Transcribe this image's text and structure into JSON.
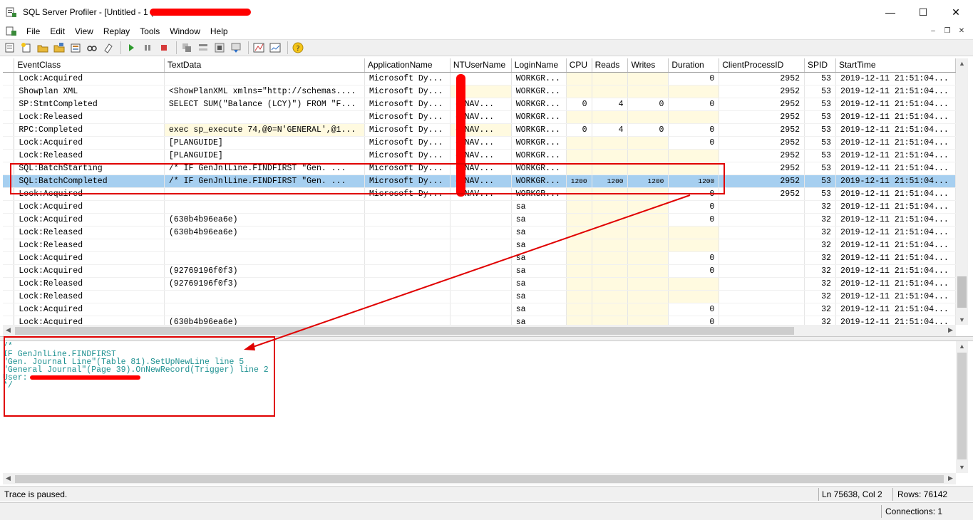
{
  "window": {
    "title": "SQL Server Profiler - [Untitled - 1 (",
    "minimize": "—",
    "maximize": "☐",
    "close": "✕"
  },
  "menu": {
    "items": [
      "File",
      "Edit",
      "View",
      "Replay",
      "Tools",
      "Window",
      "Help"
    ],
    "mdi": [
      "–",
      "❐",
      "✕"
    ]
  },
  "toolbar": {
    "icons": [
      "new-trace-icon",
      "new-template-icon",
      "open-icon",
      "save-icon",
      "properties-icon",
      "find-icon",
      "clear-trace-icon",
      "run-icon",
      "pause-icon",
      "stop-icon",
      "step-icon",
      "step-icon",
      "go-to-line-icon",
      "auto-scroll-icon",
      "performance-monitor-icon",
      "chart-icon",
      "help-icon"
    ]
  },
  "grid": {
    "columns": [
      "",
      "EventClass",
      "TextData",
      "ApplicationName",
      "NTUserName",
      "LoginName",
      "CPU",
      "Reads",
      "Writes",
      "Duration",
      "ClientProcessID",
      "SPID",
      "StartTime"
    ],
    "rows": [
      {
        "sel": false,
        "cells": [
          "",
          "Lock:Acquired",
          "",
          "Microsoft Dy...",
          "",
          "WORKGR...",
          "",
          "",
          "",
          "0",
          "2952",
          "53",
          "2019-12-11 21:51:04..."
        ],
        "yellow": [
          6,
          7,
          8
        ]
      },
      {
        "sel": false,
        "cells": [
          "",
          "Showplan XML",
          "<ShowPlanXML xmlns=\"http://schemas....",
          "Microsoft Dy...",
          "",
          "WORKGR...",
          "",
          "",
          "",
          "",
          "2952",
          "53",
          "2019-12-11 21:51:04..."
        ],
        "yellow": [
          4,
          6,
          7,
          8,
          9
        ]
      },
      {
        "sel": false,
        "cells": [
          "",
          "SP:StmtCompleted",
          "SELECT SUM(\"Balance (LCY)\") FROM \"F...",
          "Microsoft Dy...",
          "--NAV...",
          "WORKGR...",
          "0",
          "4",
          "0",
          "0",
          "2952",
          "53",
          "2019-12-11 21:51:04..."
        ],
        "yellow": []
      },
      {
        "sel": false,
        "cells": [
          "",
          "Lock:Released",
          "",
          "Microsoft Dy...",
          "--NAV...",
          "WORKGR...",
          "",
          "",
          "",
          "",
          "2952",
          "53",
          "2019-12-11 21:51:04..."
        ],
        "yellow": [
          6,
          7,
          8,
          9
        ]
      },
      {
        "sel": false,
        "cells": [
          "",
          "RPC:Completed",
          "exec sp_execute 74,@0=N'GENERAL',@1...",
          "Microsoft Dy...",
          "--NAV...",
          "WORKGR...",
          "0",
          "4",
          "0",
          "0",
          "2952",
          "53",
          "2019-12-11 21:51:04..."
        ],
        "yellow": [
          2,
          4
        ]
      },
      {
        "sel": false,
        "cells": [
          "",
          "Lock:Acquired",
          "[PLANGUIDE]",
          "Microsoft Dy...",
          "--NAV...",
          "WORKGR...",
          "",
          "",
          "",
          "0",
          "2952",
          "53",
          "2019-12-11 21:51:04..."
        ],
        "yellow": [
          6,
          7,
          8
        ]
      },
      {
        "sel": false,
        "cells": [
          "",
          "Lock:Released",
          "[PLANGUIDE]",
          "Microsoft Dy...",
          "--NAV...",
          "WORKGR...",
          "",
          "",
          "",
          "",
          "2952",
          "53",
          "2019-12-11 21:51:04..."
        ],
        "yellow": [
          6,
          7,
          8,
          9
        ]
      },
      {
        "sel": false,
        "cells": [
          "",
          "SQL:BatchStarting",
          "/*  IF GenJnlLine.FINDFIRST  \"Gen. ...",
          "Microsoft Dy...",
          "--NAV...",
          "WORKGR...",
          "",
          "",
          "",
          "",
          "2952",
          "53",
          "2019-12-11 21:51:04..."
        ],
        "yellow": [
          6,
          7,
          8,
          9
        ]
      },
      {
        "sel": true,
        "cells": [
          "",
          "SQL:BatchCompleted",
          "/*  IF GenJnlLine.FINDFIRST  \"Gen. ...",
          "Microsoft Dy...",
          "--NAV...",
          "WORKGR...",
          "1200",
          "1200",
          "1200",
          "1200",
          "2952",
          "53",
          "2019-12-11 21:51:04..."
        ],
        "yellow": []
      },
      {
        "sel": false,
        "cells": [
          "",
          "Lock:Acquired",
          "",
          "Microsoft Dy...",
          "--NAV...",
          "WORKGR...",
          "",
          "",
          "",
          "0",
          "2952",
          "53",
          "2019-12-11 21:51:04..."
        ],
        "yellow": [
          6,
          7,
          8
        ]
      },
      {
        "sel": false,
        "cells": [
          "",
          "Lock:Acquired",
          "",
          "",
          "",
          "sa",
          "",
          "",
          "",
          "0",
          "",
          "32",
          "2019-12-11 21:51:04..."
        ],
        "yellow": [
          6,
          7,
          8
        ]
      },
      {
        "sel": false,
        "cells": [
          "",
          "Lock:Acquired",
          "(630b4b96ea6e)",
          "",
          "",
          "sa",
          "",
          "",
          "",
          "0",
          "",
          "32",
          "2019-12-11 21:51:04..."
        ],
        "yellow": [
          6,
          7,
          8
        ]
      },
      {
        "sel": false,
        "cells": [
          "",
          "Lock:Released",
          "(630b4b96ea6e)",
          "",
          "",
          "sa",
          "",
          "",
          "",
          "",
          "",
          "32",
          "2019-12-11 21:51:04..."
        ],
        "yellow": [
          6,
          7,
          8,
          9
        ]
      },
      {
        "sel": false,
        "cells": [
          "",
          "Lock:Released",
          "",
          "",
          "",
          "sa",
          "",
          "",
          "",
          "",
          "",
          "32",
          "2019-12-11 21:51:04..."
        ],
        "yellow": [
          6,
          7,
          8,
          9
        ]
      },
      {
        "sel": false,
        "cells": [
          "",
          "Lock:Acquired",
          "",
          "",
          "",
          "sa",
          "",
          "",
          "",
          "0",
          "",
          "32",
          "2019-12-11 21:51:04..."
        ],
        "yellow": [
          6,
          7,
          8
        ]
      },
      {
        "sel": false,
        "cells": [
          "",
          "Lock:Acquired",
          "(92769196f0f3)",
          "",
          "",
          "sa",
          "",
          "",
          "",
          "0",
          "",
          "32",
          "2019-12-11 21:51:04..."
        ],
        "yellow": [
          6,
          7,
          8
        ]
      },
      {
        "sel": false,
        "cells": [
          "",
          "Lock:Released",
          "(92769196f0f3)",
          "",
          "",
          "sa",
          "",
          "",
          "",
          "",
          "",
          "32",
          "2019-12-11 21:51:04..."
        ],
        "yellow": [
          6,
          7,
          8,
          9
        ]
      },
      {
        "sel": false,
        "cells": [
          "",
          "Lock:Released",
          "",
          "",
          "",
          "sa",
          "",
          "",
          "",
          "",
          "",
          "32",
          "2019-12-11 21:51:04..."
        ],
        "yellow": [
          6,
          7,
          8,
          9
        ]
      },
      {
        "sel": false,
        "cells": [
          "",
          "Lock:Acquired",
          "",
          "",
          "",
          "sa",
          "",
          "",
          "",
          "0",
          "",
          "32",
          "2019-12-11 21:51:04..."
        ],
        "yellow": [
          6,
          7,
          8
        ]
      },
      {
        "sel": false,
        "cells": [
          "",
          "Lock:Acquired",
          "(630b4b96ea6e)",
          "",
          "",
          "sa",
          "",
          "",
          "",
          "0",
          "",
          "32",
          "2019-12-11 21:51:04..."
        ],
        "yellow": [
          6,
          7,
          8
        ]
      }
    ]
  },
  "textdata": {
    "lines": [
      "/*",
      "IF GenJnlLine.FINDFIRST",
      "\"Gen. Journal Line\"(Table 81).SetUpNewLine line 5",
      "\"General Journal\"(Page 39).OnNewRecord(Trigger) line 2",
      "User:",
      "*/"
    ]
  },
  "status": {
    "message": "Trace is paused.",
    "position": "Ln 75638, Col 2",
    "rows": "Rows: 76142",
    "connections": "Connections: 1"
  }
}
